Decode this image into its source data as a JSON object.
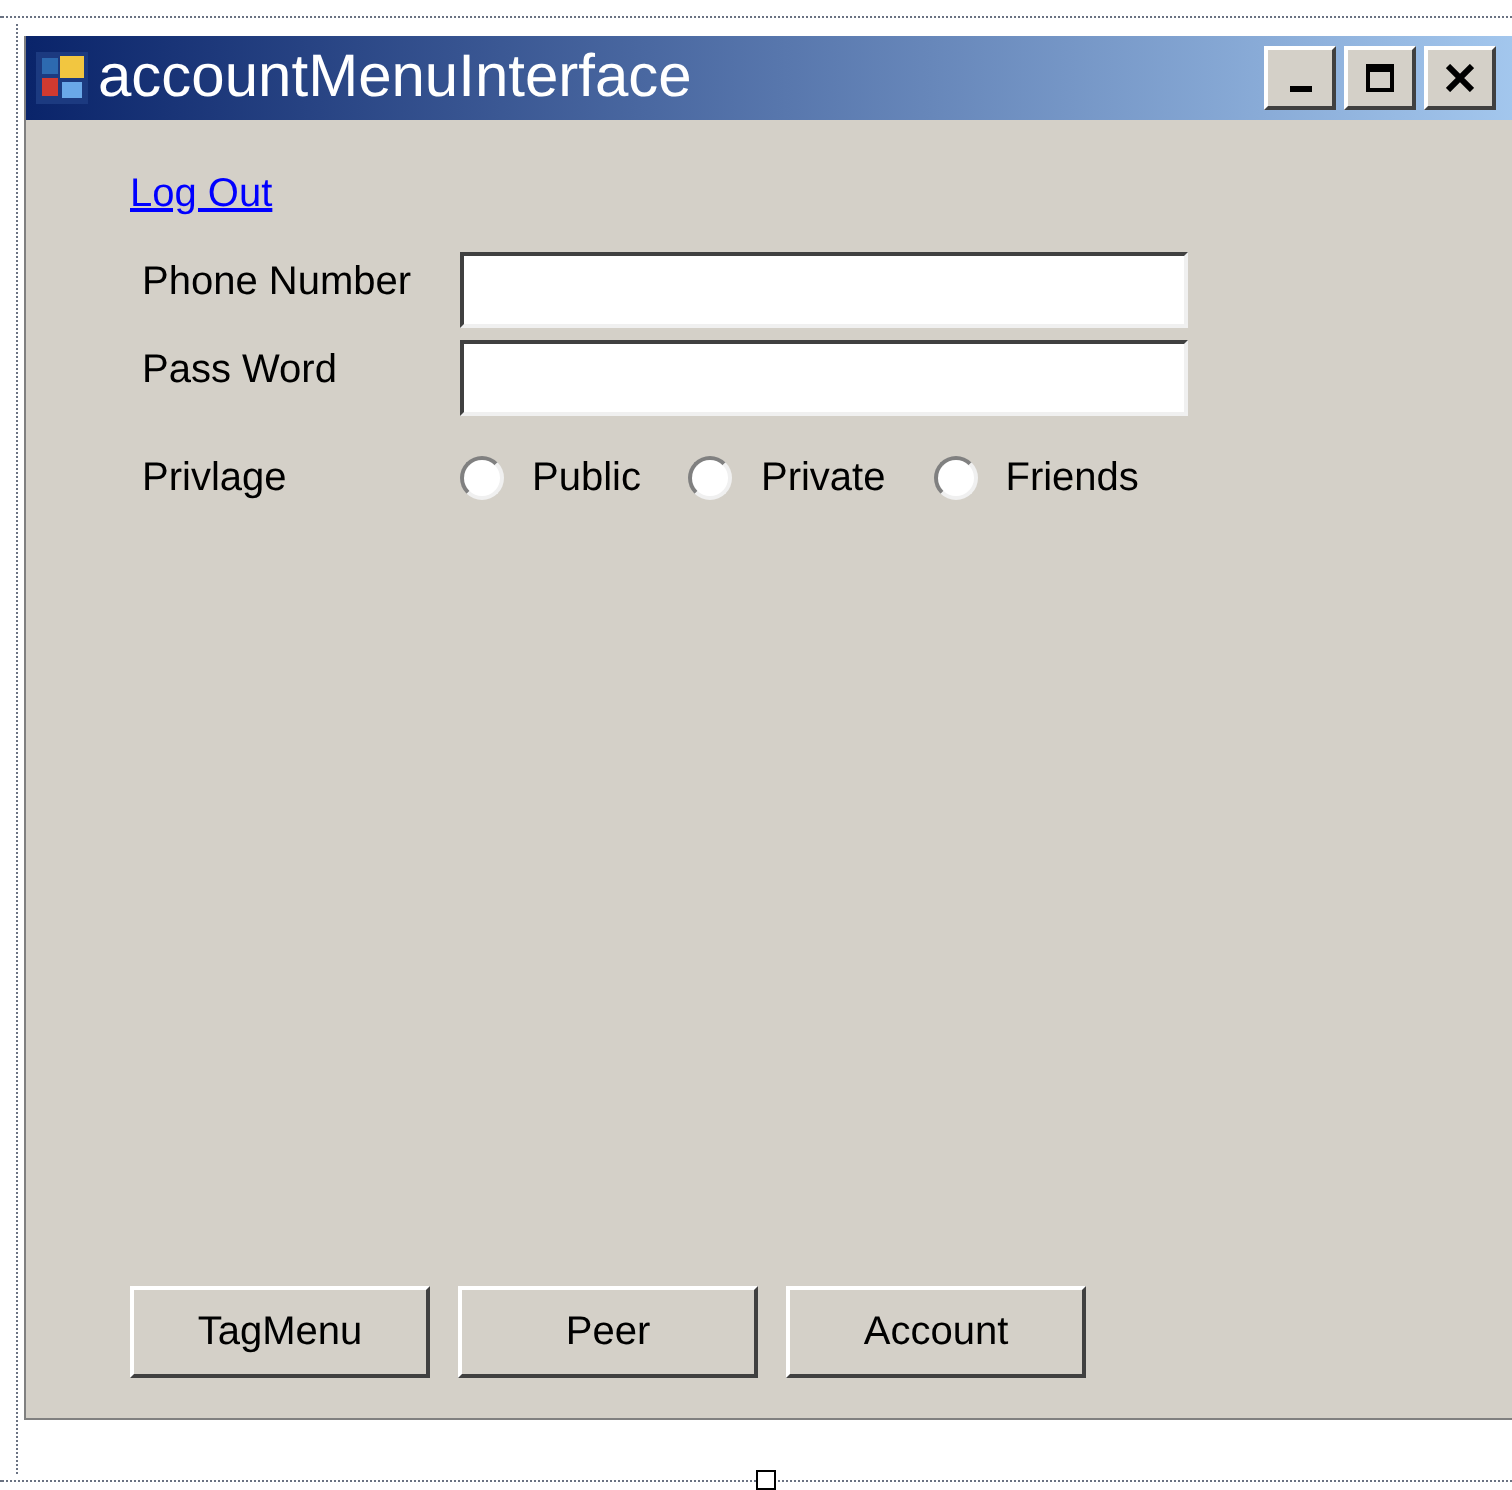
{
  "window": {
    "title": "accountMenuInterface"
  },
  "log_out_link": "Log Out",
  "fields": [
    {
      "label": "Phone Number"
    },
    {
      "label": "Pass Word"
    }
  ],
  "privilege": {
    "label": "Privlage",
    "options": [
      {
        "label": "Public",
        "selected": false
      },
      {
        "label": "Private",
        "selected": false
      },
      {
        "label": "Friends",
        "selected": false
      }
    ]
  },
  "buttons": [
    "TagMenu",
    "Peer",
    "Account"
  ]
}
